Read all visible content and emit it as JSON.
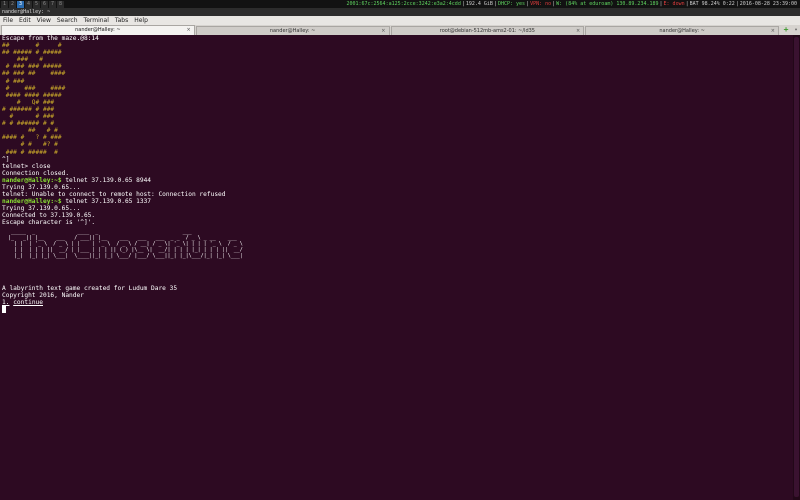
{
  "statusbar": {
    "workspaces": [
      "1",
      "2",
      "3",
      "4",
      "5",
      "6",
      "7",
      "8"
    ],
    "active_workspace": 3,
    "ipv6": "2001:67c:2564:a125:2cce:3242:e3a2:4cdd",
    "disk": "192.4 GiB",
    "dhcp": "DHCP: yes",
    "vpn": "VPN: no",
    "wifi": "W: (84% at eduroam) 130.89.234.189",
    "eth": "E: down",
    "battery": "BAT 98.24% 0:22",
    "datetime": "2016-08-28 23:39:00",
    "colors": {
      "green": "#5fd35f",
      "red": "#e33d3d",
      "text": "#cfcfcf"
    }
  },
  "window": {
    "title": "nander@Halley: ~"
  },
  "menu": [
    "File",
    "Edit",
    "View",
    "Search",
    "Terminal",
    "Tabs",
    "Help"
  ],
  "tabs": [
    {
      "label": "nander@Halley: ~",
      "active": true
    },
    {
      "label": "nander@Halley: ~",
      "active": false
    },
    {
      "label": "root@debian-512mb-ams2-01: ~/ld35",
      "active": false
    },
    {
      "label": "nander@Halley: ~",
      "active": false
    }
  ],
  "tab_icons": {
    "close": "×",
    "new_tab": "+",
    "tab_menu": "▾"
  },
  "terminal": {
    "colors": {
      "background": "#2d0a22",
      "text": "#ffffff",
      "maze": "#ccab2a",
      "prompt": "#8ae234"
    },
    "header": "Escape from the maze.@8:14",
    "maze_lines": [
      "##       #     #",
      "## ##### # #####",
      "    ###   #",
      " # ### ### #####",
      "## ### ##    ####",
      " # ###",
      " #    ###    ####",
      " #### #### #####",
      "    #   Q# ###",
      "# ###### # ###",
      "  #      # ###",
      "# # ###### # #",
      "       ##   # #",
      "#### #   ? # ###",
      "     # #   #? #",
      " ### # #####  #"
    ],
    "escape_char": "^]",
    "lines_after_maze": [
      "telnet> close",
      "Connection closed."
    ],
    "prompt_label": "nander@Halley:~$",
    "cmd1": " telnet 37.139.0.65 8944",
    "lines_cmd1": [
      "Trying 37.139.0.65...",
      "telnet: Unable to connect to remote host: Connection refused"
    ],
    "cmd2": " telnet 37.139.0.65 1337",
    "lines_cmd2": [
      "Trying 37.139.0.65...",
      "Connected to 37.139.0.65.",
      "Escape character is '^]'."
    ],
    "banner": [
      " _____  _              ____  _                            ___",
      "|_   _|| |__    ___   / ___|| |__    ___   ___   ___  _ _  / _ \\ _ __    ___",
      "  | |  | '_ \\  / _ \\ | |    | '_ \\  / _ \\ / __| / _ \\| '_ \\| | | | '_ \\  / _ \\",
      "  | |  | | | ||  __/ | |___ | | | || (_) |\\__ \\|  __/| | | | |_| | | | ||  __/",
      "  |_|  |_| |_| \\___|  \\____||_| |_| \\___/ |___/ \\___||_| |_|\\___/|_| |_| \\___|"
    ],
    "footer": [
      "A labyrinth text game created for Ludum Dare 35",
      "Copyright 2016, Nander"
    ],
    "option_number": "1.",
    "option_label": "continue"
  }
}
